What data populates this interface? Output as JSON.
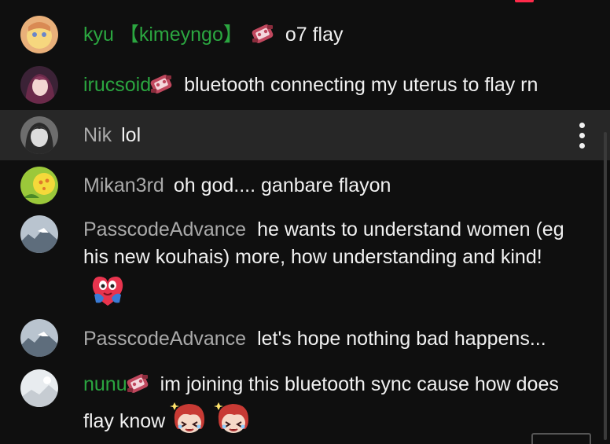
{
  "messages": [
    {
      "author": "kyu 【kimeyngo】",
      "text": "o7 flay",
      "badge": true
    },
    {
      "author": "irucsoid",
      "text": "bluetooth connecting my uterus to flay rn",
      "badge": true
    },
    {
      "author": "Nik",
      "text": "lol"
    },
    {
      "author": "Mikan3rd",
      "text": "oh god.... ganbare flayon"
    },
    {
      "author": "PasscodeAdvance",
      "text": "he wants to understand women (eg his new kouhais) more, how understanding and kind!"
    },
    {
      "author": "PasscodeAdvance",
      "text": "let's hope nothing bad happens..."
    },
    {
      "author": "nunu",
      "text": "im joining this bluetooth sync cause how does flay know",
      "badge": true
    }
  ],
  "colors": {
    "background": "#0f0f0f",
    "highlight_row": "#272727",
    "member_name": "#2ba640",
    "regular_name": "#aaaaaa",
    "message_text": "#f1f1f1"
  },
  "icons": {
    "member_badge": "member-badge-icon",
    "menu": "more-vert-icon",
    "hug_emoji": "hug-emoji-icon",
    "cry_emoji": "crying-character-emoji-icon"
  }
}
